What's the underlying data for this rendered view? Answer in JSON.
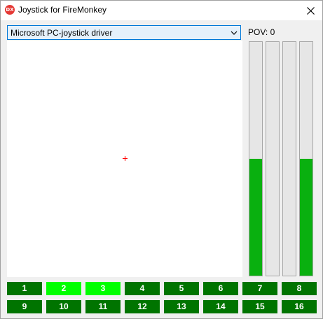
{
  "window": {
    "title": "Joystick for FireMonkey",
    "icon_text": "DX",
    "close_icon": "close-icon"
  },
  "device_select": {
    "value": "Microsoft PC-joystick driver",
    "icon": "chevron-down-icon"
  },
  "pov": {
    "label": "POV: 0"
  },
  "crosshair": {
    "x_fraction": 0.5,
    "y_fraction": 0.5,
    "color": "#ff0000"
  },
  "axes": [
    {
      "level": 0.5
    },
    {
      "level": 0.0
    },
    {
      "level": 0.0
    },
    {
      "level": 0.5
    }
  ],
  "buttons": [
    {
      "label": "1",
      "pressed": false
    },
    {
      "label": "2",
      "pressed": true
    },
    {
      "label": "3",
      "pressed": true
    },
    {
      "label": "4",
      "pressed": false
    },
    {
      "label": "5",
      "pressed": false
    },
    {
      "label": "6",
      "pressed": false
    },
    {
      "label": "7",
      "pressed": false
    },
    {
      "label": "8",
      "pressed": false
    },
    {
      "label": "9",
      "pressed": false
    },
    {
      "label": "10",
      "pressed": false
    },
    {
      "label": "11",
      "pressed": false
    },
    {
      "label": "12",
      "pressed": false
    },
    {
      "label": "13",
      "pressed": false
    },
    {
      "label": "14",
      "pressed": false
    },
    {
      "label": "15",
      "pressed": false
    },
    {
      "label": "16",
      "pressed": false
    }
  ],
  "colors": {
    "button_off": "#007400",
    "button_on": "#00ff00",
    "axis_fill": "#09b00f",
    "select_border": "#0078d7"
  }
}
